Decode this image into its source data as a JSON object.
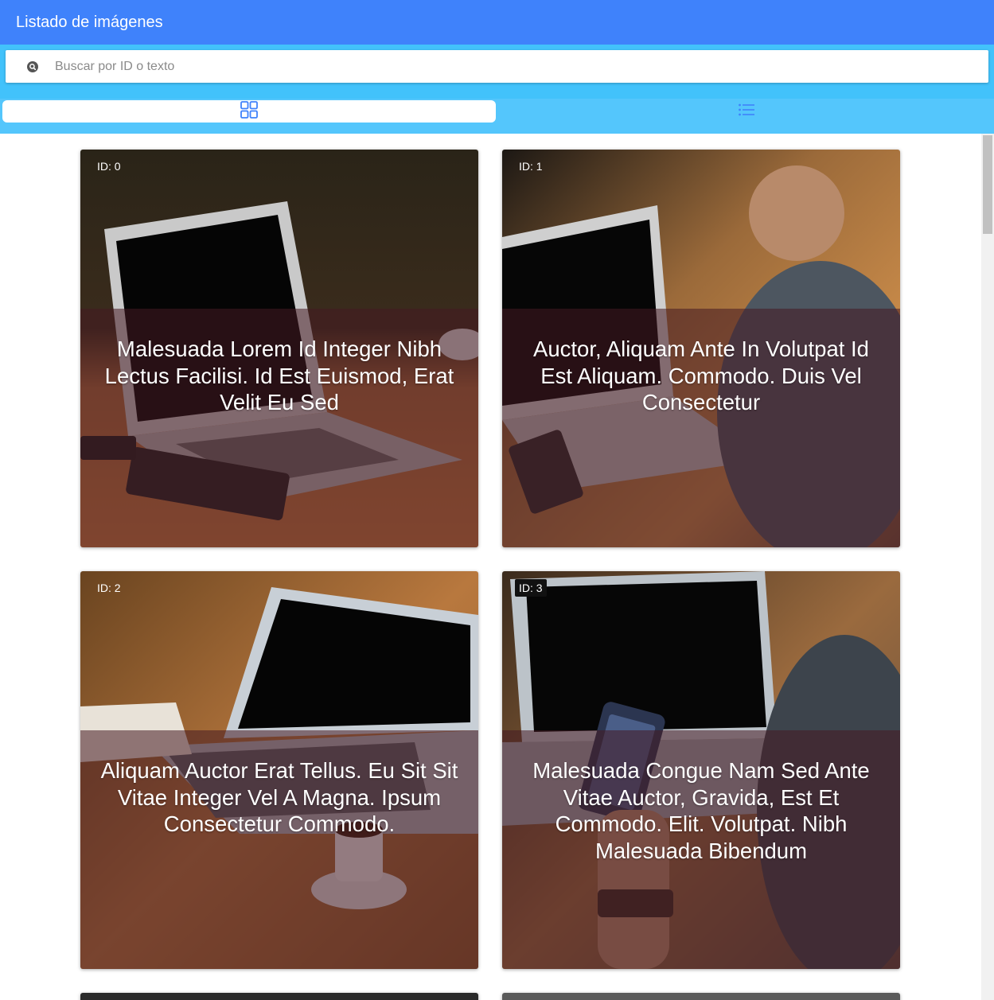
{
  "app": {
    "title": "Listado de imágenes"
  },
  "search": {
    "placeholder": "Buscar por ID o texto",
    "value": ""
  },
  "tabs": [
    {
      "name": "grid-view",
      "icon": "grid-icon",
      "active": true
    },
    {
      "name": "list-view",
      "icon": "list-icon",
      "active": false
    }
  ],
  "colors": {
    "appbar": "#3f82fb",
    "toolbar": "#42c2fb",
    "tabs": "#54c6fc",
    "accent_icon": "#3f82fb"
  },
  "cards": [
    {
      "id_label": "ID: 0",
      "title": "Malesuada Lorem Id Integer Nibh Lectus Facilisi. Id Est Euismod, Erat Velit Eu Sed"
    },
    {
      "id_label": "ID: 1",
      "title": "Auctor, Aliquam Ante In Volutpat Id Est Aliquam. Commodo. Duis Vel Consectetur"
    },
    {
      "id_label": "ID: 2",
      "title": "Aliquam Auctor Erat Tellus. Eu Sit Sit Vitae Integer Vel A Magna. Ipsum Consectetur Commodo."
    },
    {
      "id_label": "ID: 3",
      "title": "Malesuada Congue Nam Sed Ante Vitae Auctor, Gravida, Est Et Commodo. Elit. Volutpat. Nibh Malesuada Bibendum"
    }
  ]
}
